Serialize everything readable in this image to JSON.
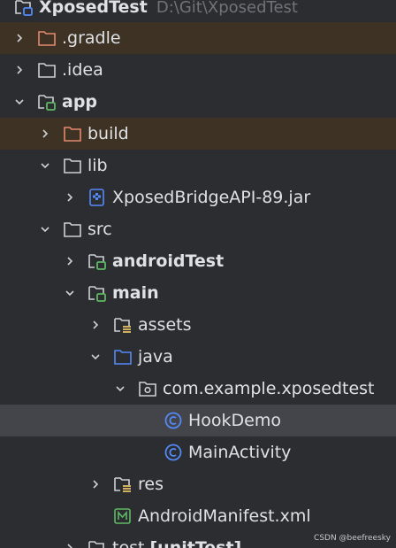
{
  "tree": {
    "project": {
      "name": "XposedTest",
      "path": "D:\\Git\\XposedTest"
    },
    "items": [
      {
        "label": "XposedTest",
        "icon": "project-module-folder-icon",
        "expanded": true
      },
      {
        "label": ".gradle",
        "icon": "excluded-folder-icon",
        "expanded": false
      },
      {
        "label": ".idea",
        "icon": "folder-icon",
        "expanded": false
      },
      {
        "label": "app",
        "icon": "module-folder-icon",
        "expanded": true
      },
      {
        "label": "build",
        "icon": "excluded-folder-icon",
        "expanded": false
      },
      {
        "label": "lib",
        "icon": "folder-icon",
        "expanded": true
      },
      {
        "label": "XposedBridgeAPI-89.jar",
        "icon": "jar-file-icon"
      },
      {
        "label": "src",
        "icon": "folder-icon",
        "expanded": true
      },
      {
        "label": "androidTest",
        "icon": "module-folder-icon",
        "expanded": false
      },
      {
        "label": "main",
        "icon": "module-folder-icon",
        "expanded": true
      },
      {
        "label": "assets",
        "icon": "resource-folder-icon",
        "expanded": false
      },
      {
        "label": "java",
        "icon": "source-folder-icon",
        "expanded": true
      },
      {
        "label": "com.example.xposedtest",
        "icon": "package-icon",
        "expanded": true
      },
      {
        "label": "HookDemo",
        "icon": "class-icon"
      },
      {
        "label": "MainActivity",
        "icon": "class-icon"
      },
      {
        "label": "res",
        "icon": "resource-folder-icon",
        "expanded": false
      },
      {
        "label": "AndroidManifest.xml",
        "icon": "manifest-file-icon"
      },
      {
        "label": "test",
        "icon": "test-folder-icon",
        "expanded": false
      },
      {
        "label": "[unitTest]"
      }
    ]
  },
  "watermark": "CSDN @beefreesky",
  "colors": {
    "background": "#2b2d30",
    "excluded_row": "#3d3223",
    "selected_row": "#43454a",
    "class_icon": "#548af7",
    "module_dot": "#5fb865",
    "excluded_folder": "#e5896f"
  }
}
